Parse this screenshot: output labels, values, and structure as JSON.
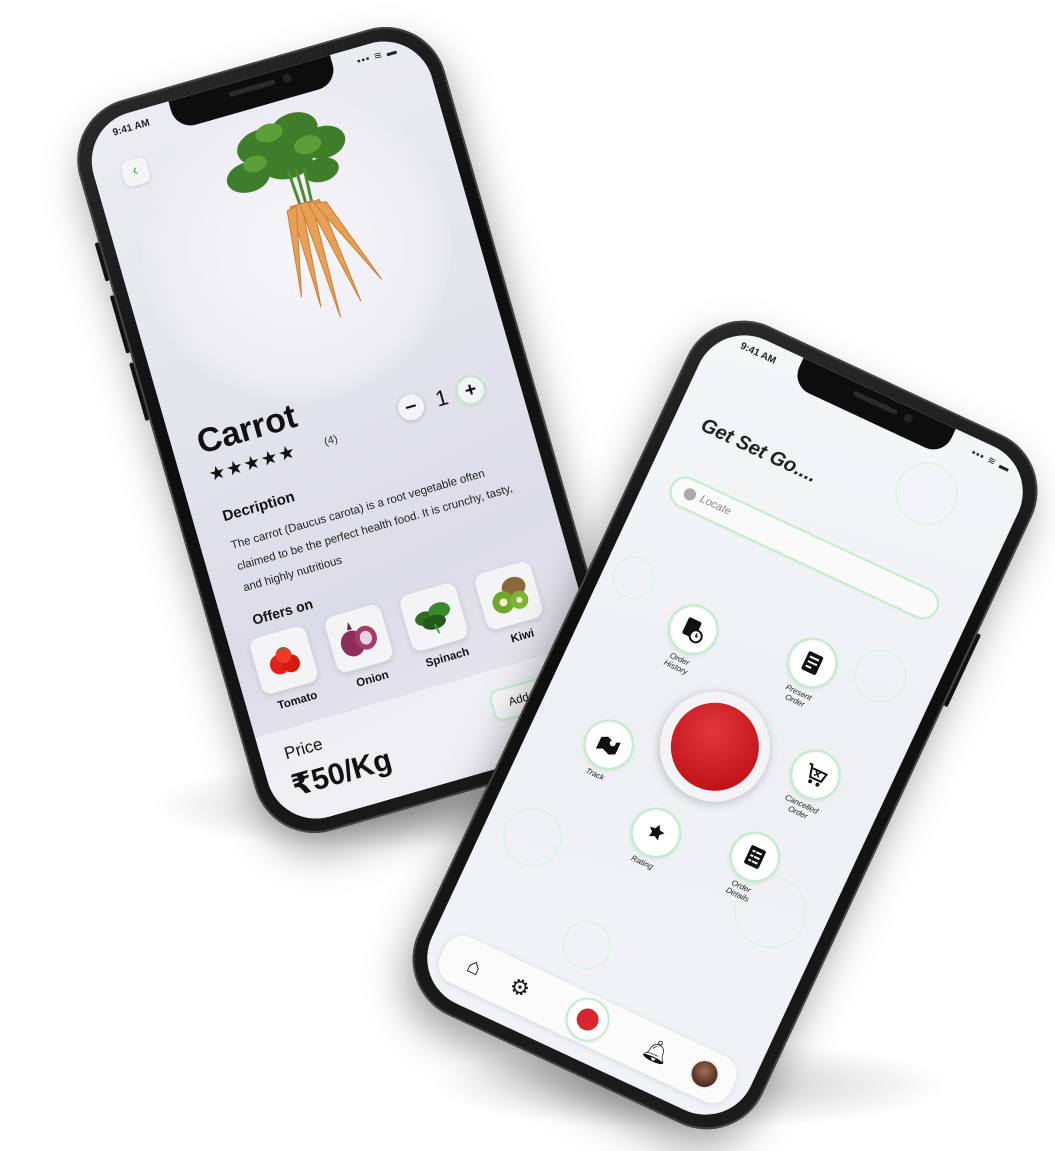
{
  "status": {
    "time": "9:41 AM",
    "signal": "▪▪▪ ≋ ▬"
  },
  "product": {
    "name": "Carrot",
    "stars": "★★★★★",
    "rating_count": "(4)",
    "quantity": "1",
    "qty_minus": "−",
    "qty_plus": "+",
    "description_heading": "Decription",
    "description": "The carrot (Daucus carota) is a root vegetable often claimed to be the perfect health food. It is crunchy, tasty, and highly nutritious",
    "offers_heading": "Offers on",
    "offers": [
      {
        "label": "Tomato",
        "icon": "tomato-icon"
      },
      {
        "label": "Onion",
        "icon": "onion-icon"
      },
      {
        "label": "Spinach",
        "icon": "spinach-icon"
      },
      {
        "label": "Kiwi",
        "icon": "kiwi-icon"
      }
    ],
    "price_label": "Price",
    "price_value": "₹50/Kg",
    "add_to_cart": "Add To Cart",
    "back_icon": "chevron-left-icon"
  },
  "home": {
    "headline": "Get Set Go....",
    "locate_placeholder": "Locate",
    "menu": {
      "present_order": "Present Order",
      "order_history": "Order History",
      "cancelled_order": "Cancelled Order",
      "track": "Track",
      "rating": "Rating",
      "order_details": "Order Details"
    },
    "nav_icons": [
      "home-icon",
      "gear-icon",
      "record-icon",
      "bell-icon",
      "avatar"
    ]
  },
  "colors": {
    "accent_green": "#2bb24c",
    "record_red": "#c4151c"
  }
}
